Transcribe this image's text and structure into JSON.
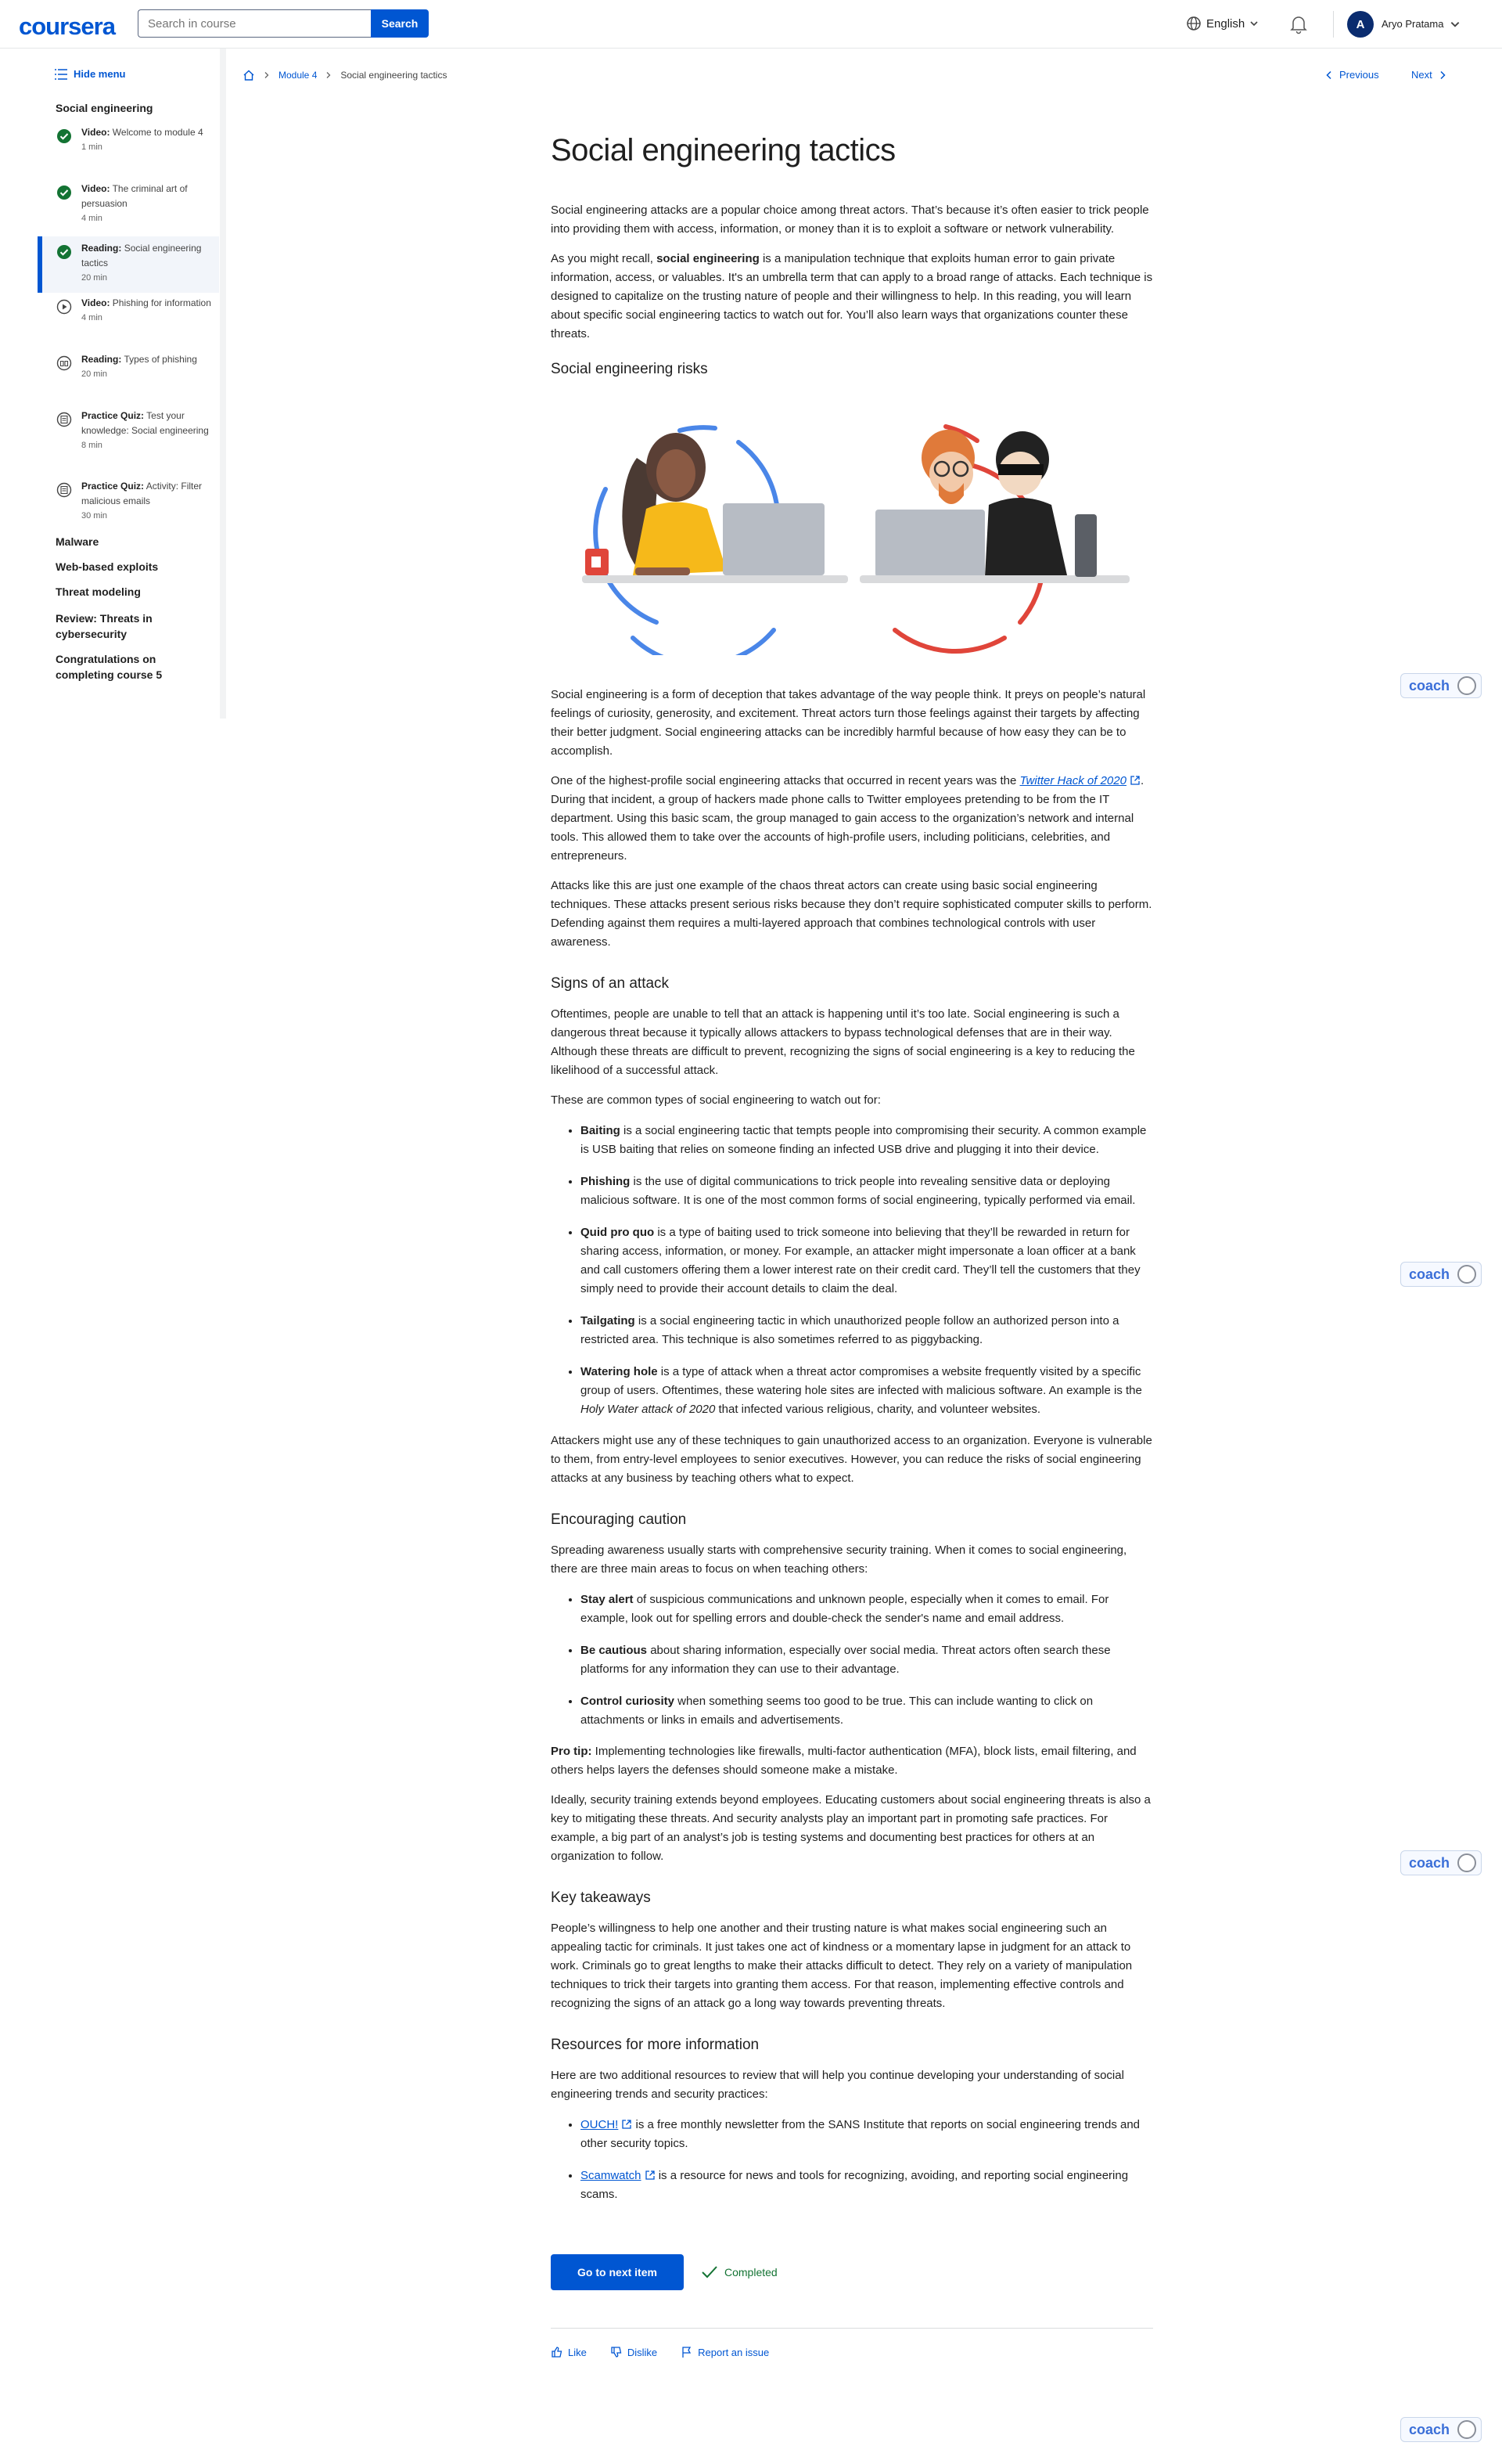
{
  "header": {
    "logo": "coursera",
    "search_placeholder": "Search in course",
    "search_button": "Search",
    "language": "English",
    "user_initial": "A",
    "user_name": "Aryo Pratama"
  },
  "sidebar": {
    "hide_menu": "Hide menu",
    "section": "Social engineering",
    "items": [
      {
        "type": "Video:",
        "title": "Welcome to module 4",
        "duration": "1 min",
        "status": "completed"
      },
      {
        "type": "Video:",
        "title": "The criminal art of persuasion",
        "duration": "4 min",
        "status": "completed"
      },
      {
        "type": "Reading:",
        "title": "Social engineering tactics",
        "duration": "20 min",
        "status": "completed"
      },
      {
        "type": "Video:",
        "title": "Phishing for information",
        "duration": "4 min",
        "status": "video"
      },
      {
        "type": "Reading:",
        "title": "Types of phishing",
        "duration": "20 min",
        "status": "reading"
      },
      {
        "type": "Practice Quiz:",
        "title": "Test your knowledge: Social engineering",
        "duration": "8 min",
        "status": "quiz"
      },
      {
        "type": "Practice Quiz:",
        "title": "Activity: Filter malicious emails",
        "duration": "30 min",
        "status": "quiz"
      }
    ],
    "sections": [
      "Malware",
      "Web-based exploits",
      "Threat modeling",
      "Review: Threats in cybersecurity",
      "Congratulations on completing course 5"
    ]
  },
  "breadcrumb": {
    "module": "Module 4",
    "current": "Social engineering tactics"
  },
  "nav": {
    "previous": "Previous",
    "next": "Next"
  },
  "article": {
    "title": "Social engineering tactics",
    "intro": "Social engineering attacks are a popular choice among threat actors. That’s because it’s often easier to trick people into providing them with access, information, or money than it is to exploit a software or network vulnerability.",
    "recall_pre": "As you might recall, ",
    "recall_bold": "social engineering",
    "recall_post": " is a manipulation technique that exploits human error to gain private information, access, or valuables. It's an umbrella term that can apply to a broad range of attacks. Each technique is designed to capitalize on the trusting nature of people and their willingness to help. In this reading, you will learn about specific social engineering tactics to watch out for. You’ll also learn ways that organizations counter these threats.",
    "h_risks": "Social engineering risks",
    "risks_p1": "Social engineering is a form of deception that takes advantage of the way people think. It preys on people’s natural feelings of curiosity, generosity, and excitement. Threat actors turn those feelings against their targets by affecting their better judgment. Social engineering attacks can be incredibly harmful because of how easy they can be to accomplish.",
    "risks_p2_pre": "One of the highest-profile social engineering attacks that occurred in recent years was the ",
    "risks_p2_link": "Twitter Hack of 2020",
    "risks_p2_post": ". During that incident, a group of hackers made phone calls to Twitter employees pretending to be from the IT department. Using this basic scam, the group managed to gain access to the organization’s network and internal tools. This allowed them to take over the accounts of high-profile users, including politicians, celebrities, and entrepreneurs.",
    "risks_p3": "Attacks like this are just one example of the chaos threat actors can create using basic social engineering techniques. These attacks present serious risks because they don’t require sophisticated computer skills to perform. Defending against them requires a multi-layered approach that combines technological controls with user awareness.",
    "h_signs": "Signs of an attack",
    "signs_p1": "Oftentimes, people are unable to tell that an attack is happening until it’s too late. Social engineering is such a dangerous threat because it typically allows attackers to bypass technological defenses that are in their way. Although these threats are difficult to prevent, recognizing the signs of social engineering is a key to reducing the likelihood of a successful attack.",
    "signs_p2": "These are common types of social engineering to watch out for:",
    "signs_list": [
      {
        "b": "Baiting",
        "t": " is a social engineering tactic that tempts people into compromising their security. A common example is USB baiting that relies on someone finding an infected USB drive and plugging it into their device."
      },
      {
        "b": "Phishing",
        "t": " is the use of digital communications to trick people into revealing sensitive data or deploying malicious software. It is one of the most common forms of social engineering, typically performed via email."
      },
      {
        "b": "Quid pro quo",
        "t": " is a type of baiting used to trick someone into believing that they’ll be rewarded in return for sharing access, information, or money. For example, an attacker might impersonate a loan officer at a bank and call customers offering them a lower interest rate on their credit card. They’ll tell the customers that they simply need to provide their account details to claim the deal."
      },
      {
        "b": "Tailgating",
        "t": " is a social engineering tactic in which unauthorized people follow an authorized person into a restricted area. This technique is also sometimes referred to as piggybacking."
      }
    ],
    "watering_b": "Watering hole",
    "watering_t1": " is a type of attack when a threat actor compromises a website frequently visited by a specific group of users. Oftentimes, these watering hole sites are infected with malicious software. An example is the ",
    "watering_i": "Holy Water attack of 2020",
    "watering_t2": " that infected various religious, charity, and volunteer websites.",
    "signs_p3": "Attackers might use any of these techniques to gain unauthorized access to an organization. Everyone is vulnerable to them, from entry-level employees to senior executives. However, you can reduce the risks of social engineering attacks at any business by teaching others what to expect.",
    "h_caution": "Encouraging caution",
    "caution_p1": "Spreading awareness usually starts with comprehensive security training. When it comes to social engineering, there are three main areas to focus on when teaching others:",
    "caution_list": [
      {
        "b": "Stay alert",
        "t": " of suspicious communications and unknown people, especially when it comes to email. For example, look out for spelling errors and double-check the sender's name and email address."
      },
      {
        "b": "Be cautious",
        "t": " about sharing information, especially over social media. Threat actors often search these platforms for any information they can use to their advantage."
      },
      {
        "b": "Control curiosity",
        "t": " when something seems too good to be true. This can include wanting to click on attachments or links in emails and advertisements."
      }
    ],
    "protip_b": "Pro tip:",
    "protip_t": " Implementing technologies like firewalls, multi-factor authentication (MFA), block lists, email filtering, and others helps layers the defenses should someone make a mistake.",
    "caution_p2": "Ideally, security training extends beyond employees. Educating customers about social engineering threats is also a key to mitigating these threats. And security analysts play an important part in promoting safe practices. For example, a big part of an analyst’s job is testing systems and documenting best practices for others at an organization to follow.",
    "h_takeaways": "Key takeaways",
    "takeaways_p": "People’s willingness to help one another and their trusting nature is what makes social engineering such an appealing tactic for criminals. It just takes one act of kindness or a momentary lapse in judgment for an attack to work. Criminals go to great lengths to make their attacks difficult to detect. They rely on a variety of manipulation techniques to trick their targets into granting them access. For that reason, implementing effective controls and recognizing the signs of an attack go a long way towards preventing threats.",
    "h_resources": "Resources for more information",
    "resources_p": "Here are two additional resources to review that will help you continue developing your understanding of social engineering trends and security practices:",
    "res1_link": "OUCH!",
    "res1_t": " is a free monthly newsletter from the SANS Institute that reports on social engineering trends and other security topics.",
    "res2_link": "Scamwatch",
    "res2_t": " is a resource for news and tools for recognizing, avoiding, and reporting social engineering scams."
  },
  "footer": {
    "next_button": "Go to next item",
    "completed": "Completed",
    "like": "Like",
    "dislike": "Dislike",
    "report": "Report an issue"
  },
  "coach": {
    "label": "coach"
  },
  "colors": {
    "brand": "#0056d2",
    "completed": "#137333",
    "ring_blue": "#4a86e8",
    "ring_red": "#e0453a",
    "sweater": "#f6b91a"
  }
}
